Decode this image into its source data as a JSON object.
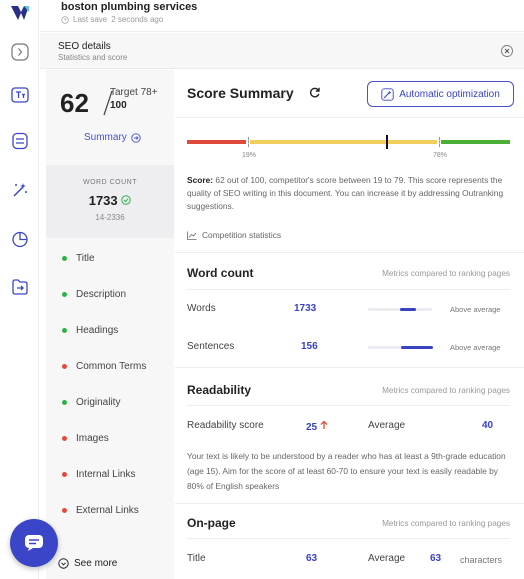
{
  "document": {
    "title": "boston plumbing services",
    "save_status": "Last save",
    "save_time": "2 seconds ago"
  },
  "subheader": {
    "title": "SEO details",
    "subtitle": "Statistics and score"
  },
  "left_panel": {
    "score": "62",
    "target_label": "Target 78+",
    "target_max": "100",
    "summary_link": "Summary",
    "word_count_label": "WORD COUNT",
    "word_count_value": "1733",
    "word_count_range": "14-2336",
    "nav_items": [
      {
        "label": "Title",
        "color": "#2bb24c"
      },
      {
        "label": "Description",
        "color": "#2bb24c"
      },
      {
        "label": "Headings",
        "color": "#2bb24c"
      },
      {
        "label": "Common Terms",
        "color": "#e04a3c"
      },
      {
        "label": "Originality",
        "color": "#2bb24c"
      },
      {
        "label": "Images",
        "color": "#e04a3c"
      },
      {
        "label": "Internal Links",
        "color": "#e04a3c"
      },
      {
        "label": "External Links",
        "color": "#e04a3c"
      }
    ],
    "see_more": "See more"
  },
  "score_summary": {
    "title": "Score Summary",
    "auto_button": "Automatic optimization",
    "score_value": 62,
    "competitor_low": 19,
    "competitor_high": 78,
    "tick_low_label": "19%",
    "tick_high_label": "78%",
    "desc_label": "Score:",
    "description": "62 out of 100, competitor's score between 19 to 79. This score represents the quality of SEO writing in this document. You can increase it by addressing Outranking suggestions.",
    "comp_stats": "Competition statistics"
  },
  "word_count_section": {
    "title": "Word count",
    "note": "Metrics compared to ranking pages",
    "rows": [
      {
        "label": "Words",
        "value": "1733",
        "fill": 0.25,
        "status": "Above average"
      },
      {
        "label": "Sentences",
        "value": "156",
        "fill": 0.5,
        "status": "Above average"
      }
    ]
  },
  "readability": {
    "title": "Readability",
    "note": "Metrics compared to ranking pages",
    "score_label": "Readability score",
    "score_value": "25",
    "avg_label": "Average",
    "avg_value": "40",
    "description": "Your text is likely to be understood by a reader who has at least a 9th-grade education (age 15). Aim for the score of at least 60-70 to ensure your text is easily readable by 80% of English speakers"
  },
  "onpage": {
    "title": "On-page",
    "note": "Metrics compared to ranking pages",
    "row_label": "Title",
    "row_value": "63",
    "avg_label": "Average",
    "avg_value": "63",
    "unit": "characters"
  },
  "colors": {
    "accent": "#3a43c2",
    "bar_red": "#e04a3c",
    "bar_yellow": "#f2cf5b",
    "bar_green": "#4caf36"
  }
}
